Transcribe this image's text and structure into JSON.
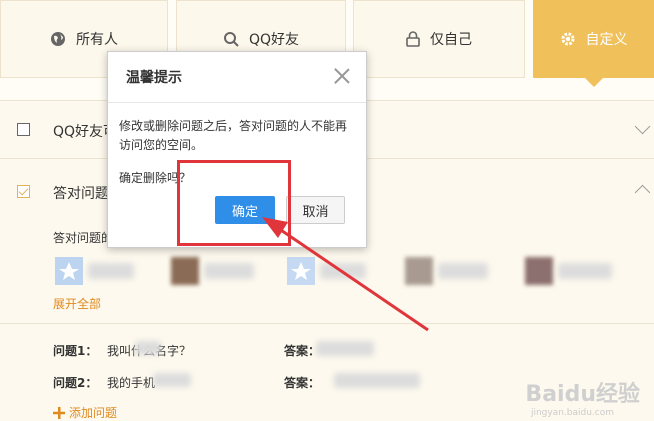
{
  "tabs": [
    {
      "label": "所有人",
      "icon": "globe-icon"
    },
    {
      "label": "QQ好友",
      "icon": "search-icon"
    },
    {
      "label": "仅自己",
      "icon": "lock-icon"
    },
    {
      "label": "自定义",
      "icon": "gear-icon",
      "active": true
    }
  ],
  "sections": {
    "qq_friends_label": "QQ好友可",
    "answer_question_label": "答对问题",
    "answer_subtext": "答对问题的",
    "expand_all": "展开全部"
  },
  "questions": [
    {
      "label": "问题1：",
      "text": "我叫什么名字？",
      "answer_label": "答案："
    },
    {
      "label": "问题2：",
      "text": "我的手机",
      "answer_label": "答案："
    }
  ],
  "add_question": "添加问题",
  "dialog": {
    "title": "温馨提示",
    "message": "修改或删除问题之后，答对问题的人不能再访问您的空间。",
    "confirm_text": "确定删除吗？",
    "ok_label": "确定",
    "cancel_label": "取消"
  },
  "watermark": {
    "text": "Baidu经验",
    "sub": "jingyan.baidu.com"
  },
  "colors": {
    "accent": "#f0c05a",
    "primary_button": "#2e8ee8",
    "highlight": "#e0353a",
    "link": "#e08a1e"
  }
}
